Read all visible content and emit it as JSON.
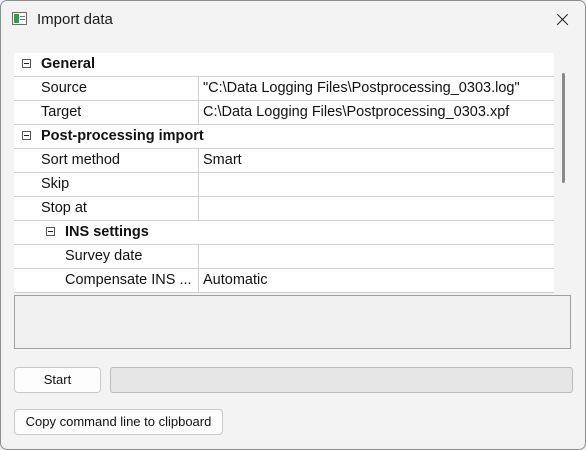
{
  "window": {
    "title": "Import data"
  },
  "grid": {
    "rows": [
      {
        "kind": "category",
        "label": "General"
      },
      {
        "kind": "property",
        "label": "Source",
        "value": "\"C:\\Data Logging Files\\Postprocessing_0303.log\""
      },
      {
        "kind": "property",
        "label": "Target",
        "value": "C:\\Data Logging Files\\Postprocessing_0303.xpf"
      },
      {
        "kind": "category",
        "label": "Post-processing import"
      },
      {
        "kind": "property",
        "label": "Sort method",
        "value": "Smart"
      },
      {
        "kind": "property",
        "label": "Skip",
        "value": ""
      },
      {
        "kind": "property",
        "label": "Stop at",
        "value": ""
      },
      {
        "kind": "subcategory",
        "label": "INS settings"
      },
      {
        "kind": "subproperty",
        "label": "Survey date",
        "value": ""
      },
      {
        "kind": "subproperty",
        "label": "Compensate INS ...",
        "value": "Automatic"
      }
    ]
  },
  "buttons": {
    "start_label": "Start",
    "copy_label": "Copy command line to clipboard"
  },
  "progress": {
    "fraction": 0
  },
  "colors": {
    "progress_fill": "#06b025"
  },
  "icons": {
    "app": "import-data-app-icon",
    "close": "close-icon",
    "expander": "collapse-minus-icon"
  }
}
